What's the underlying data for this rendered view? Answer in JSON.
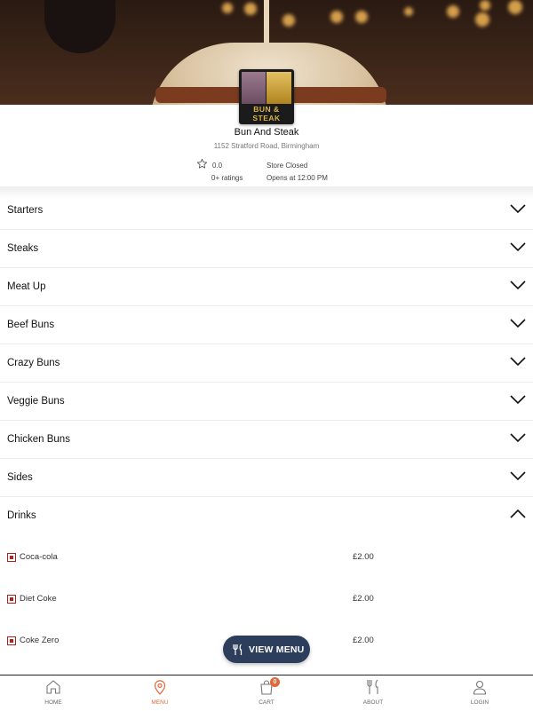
{
  "store": {
    "logo_text": "BUN & STEAK",
    "name": "Bun And Steak",
    "address": "1152 Stratford Road, Birmingham",
    "rating": "0.0",
    "rating_count": "0+ ratings",
    "status": "Store Closed",
    "opens": "Opens at 12:00 PM"
  },
  "categories": [
    {
      "label": "Starters",
      "expanded": false
    },
    {
      "label": "Steaks",
      "expanded": false
    },
    {
      "label": "Meat Up",
      "expanded": false
    },
    {
      "label": "Beef Buns",
      "expanded": false
    },
    {
      "label": "Crazy Buns",
      "expanded": false
    },
    {
      "label": "Veggie Buns",
      "expanded": false
    },
    {
      "label": "Chicken Buns",
      "expanded": false
    },
    {
      "label": "Sides",
      "expanded": false
    },
    {
      "label": "Drinks",
      "expanded": true
    }
  ],
  "drinks": [
    {
      "name": "Coca-cola",
      "price": "£2.00"
    },
    {
      "name": "Diet Coke",
      "price": "£2.00"
    },
    {
      "name": "Coke Zero",
      "price": "£2.00"
    }
  ],
  "fab": {
    "label": "VIEW MENU",
    "icon": "cutlery-icon"
  },
  "nav": {
    "tabs": [
      {
        "label": "HOME",
        "icon": "home-icon",
        "active": false
      },
      {
        "label": "MENU",
        "icon": "location-pin-icon",
        "active": true
      },
      {
        "label": "CART",
        "icon": "shopping-bag-icon",
        "active": false
      },
      {
        "label": "ABOUT",
        "icon": "cutlery-icon",
        "active": false
      },
      {
        "label": "LOGIN",
        "icon": "user-icon",
        "active": false
      }
    ],
    "cart_count": "0"
  },
  "colors": {
    "accent": "#e0683a",
    "fab": "#2d3e5c",
    "checkbox": "#b0221c"
  }
}
